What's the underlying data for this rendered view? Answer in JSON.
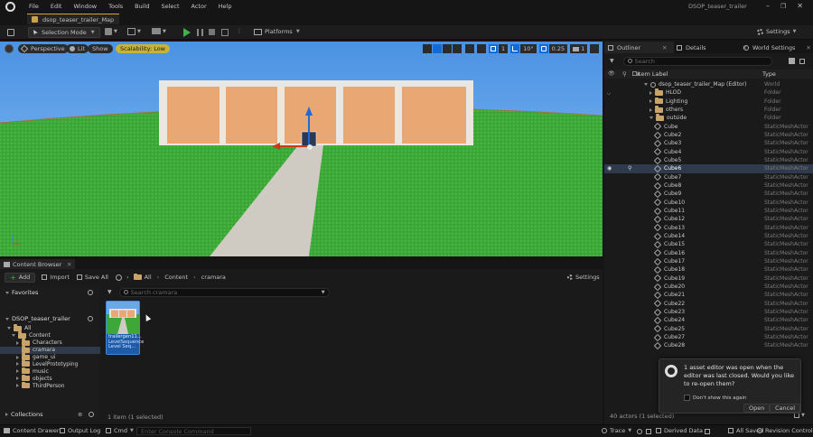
{
  "menu": {
    "items": [
      "File",
      "Edit",
      "Window",
      "Tools",
      "Build",
      "Select",
      "Actor",
      "Help"
    ],
    "project_name": "DSOP_teaser_trailer"
  },
  "tab": {
    "title": "dsop_teaser_trailer_Map"
  },
  "toolbar": {
    "selection_mode": "Selection Mode",
    "platforms": "Platforms",
    "settings": "Settings"
  },
  "viewport": {
    "perspective": "Perspective",
    "lit": "Lit",
    "show": "Show",
    "scalability": "Scalability: Low",
    "snap_value": "1",
    "angle_value": "10°",
    "scale_value": "0.25",
    "camera_speed": "1"
  },
  "outliner": {
    "tab_outliner": "Outliner",
    "tab_details": "Details",
    "tab_world_settings": "World Settings",
    "search_placeholder": "Search",
    "col_label": "Item Label",
    "col_type": "Type",
    "tree": [
      {
        "label": "dsop_teaser_trailer_Map (Editor)",
        "type": "World",
        "depth": 1,
        "kind": "world"
      },
      {
        "label": "HLOD",
        "type": "Folder",
        "depth": 2,
        "kind": "folder-closed"
      },
      {
        "label": "Lighting",
        "type": "Folder",
        "depth": 2,
        "kind": "folder-closed"
      },
      {
        "label": "others",
        "type": "Folder",
        "depth": 2,
        "kind": "folder-closed"
      },
      {
        "label": "outside",
        "type": "Folder",
        "depth": 2,
        "kind": "folder-open"
      }
    ],
    "actors": [
      {
        "label": "Cube",
        "type": "StaticMeshActor"
      },
      {
        "label": "Cube2",
        "type": "StaticMeshActor"
      },
      {
        "label": "Cube3",
        "type": "StaticMeshActor"
      },
      {
        "label": "Cube4",
        "type": "StaticMeshActor"
      },
      {
        "label": "Cube5",
        "type": "StaticMeshActor"
      },
      {
        "label": "Cube6",
        "type": "StaticMeshActor",
        "selected": true
      },
      {
        "label": "Cube7",
        "type": "StaticMeshActor"
      },
      {
        "label": "Cube8",
        "type": "StaticMeshActor"
      },
      {
        "label": "Cube9",
        "type": "StaticMeshActor"
      },
      {
        "label": "Cube10",
        "type": "StaticMeshActor"
      },
      {
        "label": "Cube11",
        "type": "StaticMeshActor"
      },
      {
        "label": "Cube12",
        "type": "StaticMeshActor"
      },
      {
        "label": "Cube13",
        "type": "StaticMeshActor"
      },
      {
        "label": "Cube14",
        "type": "StaticMeshActor"
      },
      {
        "label": "Cube15",
        "type": "StaticMeshActor"
      },
      {
        "label": "Cube16",
        "type": "StaticMeshActor"
      },
      {
        "label": "Cube17",
        "type": "StaticMeshActor"
      },
      {
        "label": "Cube18",
        "type": "StaticMeshActor"
      },
      {
        "label": "Cube19",
        "type": "StaticMeshActor"
      },
      {
        "label": "Cube20",
        "type": "StaticMeshActor"
      },
      {
        "label": "Cube21",
        "type": "StaticMeshActor"
      },
      {
        "label": "Cube22",
        "type": "StaticMeshActor"
      },
      {
        "label": "Cube23",
        "type": "StaticMeshActor"
      },
      {
        "label": "Cube24",
        "type": "StaticMeshActor"
      },
      {
        "label": "Cube25",
        "type": "StaticMeshActor"
      },
      {
        "label": "Cube27",
        "type": "StaticMeshActor"
      },
      {
        "label": "Cube28",
        "type": "StaticMeshActor"
      }
    ],
    "status": "40 actors (1 selected)"
  },
  "content_browser": {
    "tab_title": "Content Browser",
    "add": "Add",
    "import": "Import",
    "save_all": "Save All",
    "path_all": "All",
    "path_content": "Content",
    "path_current": "cramara",
    "settings": "Settings",
    "favorites": "Favorites",
    "project_section": "DSOP_teaser_trailer",
    "search_placeholder": "Search cramara",
    "tree": [
      {
        "label": "All",
        "depth": 0,
        "kind": "open"
      },
      {
        "label": "Content",
        "depth": 1,
        "kind": "open"
      },
      {
        "label": "Characters",
        "depth": 2,
        "kind": "closed"
      },
      {
        "label": "cramara",
        "depth": 2,
        "kind": "selected"
      },
      {
        "label": "game_ui",
        "depth": 2,
        "kind": "closed"
      },
      {
        "label": "LevelPrototyping",
        "depth": 2,
        "kind": "closed"
      },
      {
        "label": "music",
        "depth": 2,
        "kind": "closed"
      },
      {
        "label": "objects",
        "depth": 2,
        "kind": "closed"
      },
      {
        "label": "ThirdPerson",
        "depth": 2,
        "kind": "closed"
      }
    ],
    "collections": "Collections",
    "asset": {
      "name": "trailergen11...",
      "type_line1": "LevelSequence",
      "type_line2": "Level Seq..."
    },
    "item_count": "1 item (1 selected)"
  },
  "notification": {
    "message": "1 asset editor was open when the editor was last closed. Would you like to re-open them?",
    "checkbox_label": "Don't show this again",
    "open": "Open",
    "cancel": "Cancel"
  },
  "statusbar": {
    "content_drawer": "Content Drawer",
    "output_log": "Output Log",
    "cmd": "Cmd",
    "console_placeholder": "Enter Console Command",
    "trace": "Trace",
    "derived_data": "Derived Data",
    "all_saved": "All Saved",
    "revision_control": "Revision Control"
  },
  "colors": {
    "accent_blue": "#0e6bd8",
    "selection_blue": "#2f3b4c",
    "sky": "#5b9fe6",
    "grass": "#3da838",
    "wall": "#e9a774",
    "scalability_badge": "#c9b23a",
    "play_green": "#3fb33f"
  }
}
